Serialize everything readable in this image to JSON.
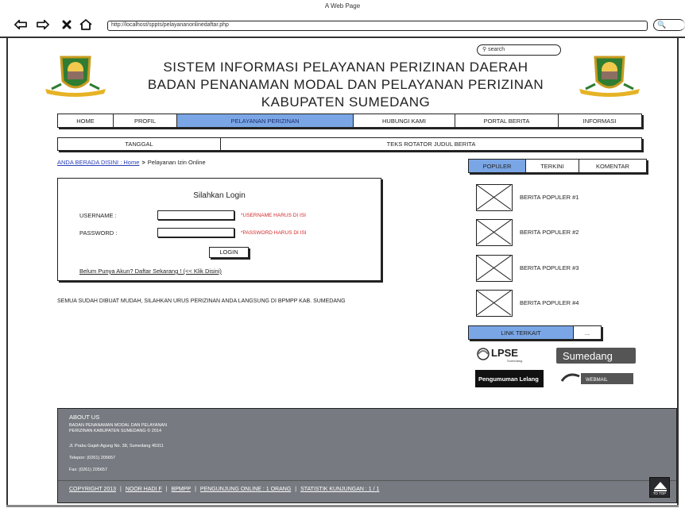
{
  "browser": {
    "window_title": "A Web Page",
    "url": "http://localhost/sppts/pelayananonlinedaftar.php"
  },
  "search": {
    "placeholder": "search"
  },
  "header": {
    "title_line1": "SISTEM INFORMASI PELAYANAN PERIZINAN DAERAH",
    "title_line2": "BADAN PENANAMAN MODAL DAN PELAYANAN PERIZINAN",
    "title_line3": "KABUPATEN SUMEDANG",
    "accent_color": "#7aa6e6"
  },
  "main_nav": [
    {
      "label": "HOME"
    },
    {
      "label": "PROFIL"
    },
    {
      "label": "PELAYANAN PERIZINAN",
      "active": true
    },
    {
      "label": "HUBUNGI KAMI"
    },
    {
      "label": "PORTAL BERITA"
    },
    {
      "label": "INFORMASI"
    }
  ],
  "ticker": {
    "date_label": "TANGGAL",
    "text": "TEKS ROTATOR JUDUL BERITA"
  },
  "breadcrumb": {
    "link": "ANDA BERADA DISINI : Home",
    "separator": ">",
    "current": "Pelayanan Izin Online"
  },
  "login": {
    "title": "Silahkan Login",
    "username_label": "USERNAME :",
    "password_label": "PASSWORD :",
    "username_hint": "*USERNAME HARUS DI ISI",
    "password_hint": "*PASSWORD HARUS DI ISI",
    "button_label": "LOGIN",
    "register_text": "Belum Punya Akun? Daftar Sekarang ! (<< Klik Disini)"
  },
  "info_text": "SEMUA SUDAH DIBUAT MUDAH, SILAHKAN URUS PERIZINAN ANDA LANGSUNG DI BPMPP KAB. SUMEDANG",
  "news_tabs": [
    {
      "label": "POPULER",
      "active": true
    },
    {
      "label": "TERKINI"
    },
    {
      "label": "KOMENTAR"
    }
  ],
  "news_items": [
    {
      "label": "BERITA POPULER #1"
    },
    {
      "label": "BERITA POPULER #2"
    },
    {
      "label": "BERITA POPULER #3"
    },
    {
      "label": "BERITA POPULER #4"
    }
  ],
  "related": {
    "label": "LINK TERKAIT",
    "more": "..."
  },
  "partners": [
    {
      "name": "LPSE",
      "sub": "Sumedang"
    },
    {
      "name": "Sumedang"
    },
    {
      "name": "Pengumuman Lelang"
    },
    {
      "name": "WEBMAIL"
    }
  ],
  "footer": {
    "about_title": "ABOUT US",
    "about_line1": "BADAN PENANAMAN MODAL DAN PELAYANAN",
    "about_line2": "PERIZINAN KABUPATEN SUMEDANG © 2014",
    "address": "Jl. Prabu Gajah Agung No. 38, Sumedang 45311",
    "phone": "Telepon: (0261) 205657",
    "fax": "Fax: (0261) 205657",
    "links": [
      "COPYRIGHT 2013",
      "NOOR HADI F",
      "BPMPP",
      "PENGUNJUNG ONLINE : 1 ORANG",
      "STATISTIK KUNJUNGAN : 1 / 1"
    ],
    "to_top_label": "TO TOP"
  }
}
